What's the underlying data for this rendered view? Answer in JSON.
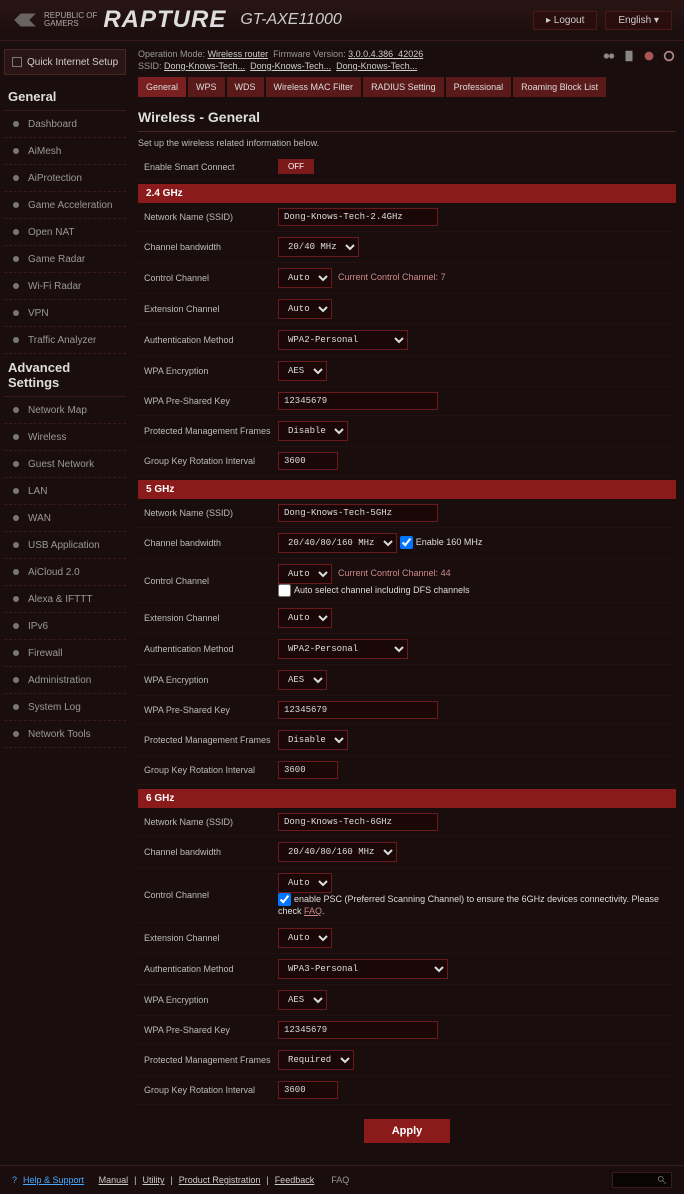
{
  "header": {
    "rog_line1": "REPUBLIC OF",
    "rog_line2": "GAMERS",
    "brand": "RAPTURE",
    "model": "GT-AXE11000",
    "logout": "Logout",
    "language": "English"
  },
  "sidebar": {
    "qis": "Quick Internet Setup",
    "general_label": "General",
    "advanced_label": "Advanced Settings",
    "general": [
      {
        "label": "Dashboard"
      },
      {
        "label": "AiMesh"
      },
      {
        "label": "AiProtection"
      },
      {
        "label": "Game Acceleration"
      },
      {
        "label": "Open NAT"
      },
      {
        "label": "Game Radar"
      },
      {
        "label": "Wi-Fi Radar"
      },
      {
        "label": "VPN"
      },
      {
        "label": "Traffic Analyzer"
      }
    ],
    "advanced": [
      {
        "label": "Network Map"
      },
      {
        "label": "Wireless"
      },
      {
        "label": "Guest Network"
      },
      {
        "label": "LAN"
      },
      {
        "label": "WAN"
      },
      {
        "label": "USB Application"
      },
      {
        "label": "AiCloud 2.0"
      },
      {
        "label": "Alexa & IFTTT"
      },
      {
        "label": "IPv6"
      },
      {
        "label": "Firewall"
      },
      {
        "label": "Administration"
      },
      {
        "label": "System Log"
      },
      {
        "label": "Network Tools"
      }
    ]
  },
  "info": {
    "op_mode_label": "Operation Mode:",
    "op_mode": "Wireless router",
    "fw_label": "Firmware Version:",
    "fw": "3.0.0.4.386_42026",
    "ssid_label": "SSID:",
    "ssid1": "Dong-Knows-Tech...",
    "ssid2": "Dong-Knows-Tech...",
    "ssid3": "Dong-Knows-Tech..."
  },
  "tabs": [
    "General",
    "WPS",
    "WDS",
    "Wireless MAC Filter",
    "RADIUS Setting",
    "Professional",
    "Roaming Block List"
  ],
  "page": {
    "title": "Wireless - General",
    "subtitle": "Set up the wireless related information below.",
    "smart_connect_label": "Enable Smart Connect",
    "smart_connect_value": "OFF",
    "apply": "Apply"
  },
  "labels": {
    "ssid": "Network Name (SSID)",
    "bw": "Channel bandwidth",
    "ctrl": "Control Channel",
    "ext": "Extension Channel",
    "auth": "Authentication Method",
    "enc": "WPA Encryption",
    "psk": "WPA Pre-Shared Key",
    "pmf": "Protected Management Frames",
    "gkri": "Group Key Rotation Interval",
    "current_ch": "Current Control Channel:",
    "enable_160": "Enable 160 MHz",
    "dfs": "Auto select channel including DFS channels",
    "psc": "enable PSC (Preferred Scanning Channel) to ensure the 6GHz devices connectivity. Please check",
    "faq": "FAQ"
  },
  "bands": {
    "b24": {
      "header": "2.4 GHz",
      "ssid": "Dong-Knows-Tech-2.4GHz",
      "bw": "20/40 MHz",
      "ctrl": "Auto",
      "ctrl_current": "7",
      "ext": "Auto",
      "auth": "WPA2-Personal",
      "enc": "AES",
      "psk": "12345679",
      "pmf": "Disable",
      "gkri": "3600"
    },
    "b5": {
      "header": "5 GHz",
      "ssid": "Dong-Knows-Tech-5GHz",
      "bw": "20/40/80/160 MHz",
      "ctrl": "Auto",
      "ctrl_current": "44",
      "ext": "Auto",
      "auth": "WPA2-Personal",
      "enc": "AES",
      "psk": "12345679",
      "pmf": "Disable",
      "gkri": "3600"
    },
    "b6": {
      "header": "6 GHz",
      "ssid": "Dong-Knows-Tech-6GHz",
      "bw": "20/40/80/160 MHz",
      "ctrl": "Auto",
      "ext": "Auto",
      "auth": "WPA3-Personal",
      "enc": "AES",
      "psk": "12345679",
      "pmf": "Required",
      "gkri": "3600"
    }
  },
  "footer": {
    "help": "Help & Support",
    "manual": "Manual",
    "utility": "Utility",
    "reg": "Product Registration",
    "feedback": "Feedback",
    "faq": "FAQ"
  }
}
